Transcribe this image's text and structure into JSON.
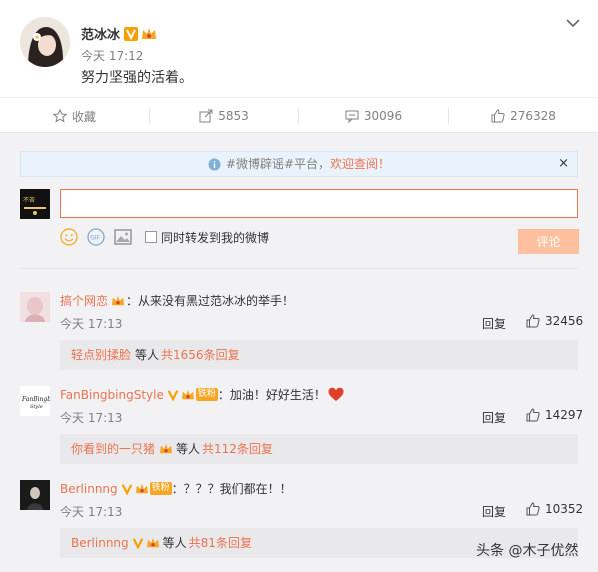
{
  "post": {
    "author": "范冰冰",
    "time": "今天 17:12",
    "text": "努力坚强的活着。"
  },
  "actions": {
    "favorite": "收藏",
    "forward": "5853",
    "comment": "30096",
    "like": "276328"
  },
  "notice": {
    "prefix": "#微博辟谣#平台，",
    "link": "欢迎查阅！",
    "close": "×"
  },
  "composer": {
    "input_value": "",
    "forward_label": "同时转发到我的微博",
    "submit_label": "评论"
  },
  "comments": [
    {
      "name": "搞个网恋",
      "text": "：从来没有黑过范冰冰的举手！",
      "time": "今天 17:13",
      "reply": "回复",
      "likes": "32456",
      "sub_name": "轻点别揉脸",
      "sub_mid": "等人",
      "sub_count": "共1656条回复"
    },
    {
      "name": "FanBingbingStyle",
      "badge": "铁粉",
      "text": "：加油！好好生活！",
      "time": "今天 17:13",
      "reply": "回复",
      "likes": "14297",
      "sub_name": "你看到的一只猪",
      "sub_mid": "等人",
      "sub_count": "共112条回复"
    },
    {
      "name": "Berlinnng",
      "badge": "铁粉",
      "text": "：？？？我们都在！！",
      "time": "今天 17:13",
      "reply": "回复",
      "likes": "10352",
      "sub_name": "Berlinnng",
      "sub_mid": "等人",
      "sub_count": "共81条回复"
    }
  ],
  "watermark": "头条 @木子优然",
  "colors": {
    "accent": "#eb7350",
    "panel_bg": "#f2f2f5",
    "fan_badge": "#f6a623"
  }
}
